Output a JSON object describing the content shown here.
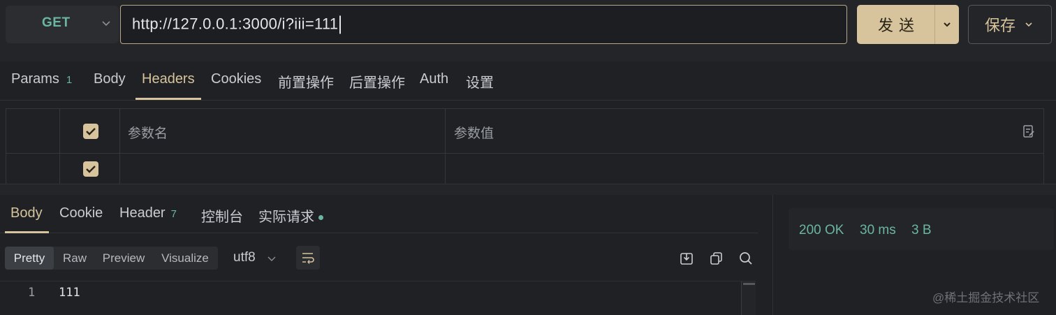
{
  "request": {
    "method": "GET",
    "url": "http://127.0.0.1:3000/i?iii=111",
    "send_label": "发送",
    "save_label": "保存"
  },
  "request_tabs": [
    {
      "label": "Params",
      "count": "1"
    },
    {
      "label": "Body"
    },
    {
      "label": "Headers",
      "active": true
    },
    {
      "label": "Cookies"
    },
    {
      "label": "前置操作"
    },
    {
      "label": "后置操作"
    },
    {
      "label": "Auth"
    },
    {
      "label": "设置"
    }
  ],
  "headers_table": {
    "col_name": "参数名",
    "col_value": "参数值",
    "rows": [
      {
        "checked": true,
        "name": "",
        "value": ""
      }
    ]
  },
  "response_tabs": [
    {
      "label": "Body",
      "active": true
    },
    {
      "label": "Cookie"
    },
    {
      "label": "Header",
      "count": "7"
    },
    {
      "label": "控制台"
    },
    {
      "label": "实际请求",
      "dot": true
    }
  ],
  "response_view": {
    "modes": [
      "Pretty",
      "Raw",
      "Preview",
      "Visualize"
    ],
    "active_mode": "Pretty",
    "encoding": "utf8"
  },
  "response_body": {
    "lines": [
      {
        "number": "1",
        "text": "111"
      }
    ]
  },
  "status": {
    "code": "200 OK",
    "time": "30 ms",
    "size": "3 B"
  },
  "watermark": "@稀土掘金技术社区",
  "icons": [
    "chevron-down-icon",
    "checkbox-checked-icon",
    "bulk-edit-icon",
    "wrap-lines-icon",
    "download-icon",
    "copy-icon",
    "search-icon"
  ],
  "colors": {
    "accent": "#d7c39c",
    "success": "#6ab6a0",
    "background": "#1f2124"
  }
}
